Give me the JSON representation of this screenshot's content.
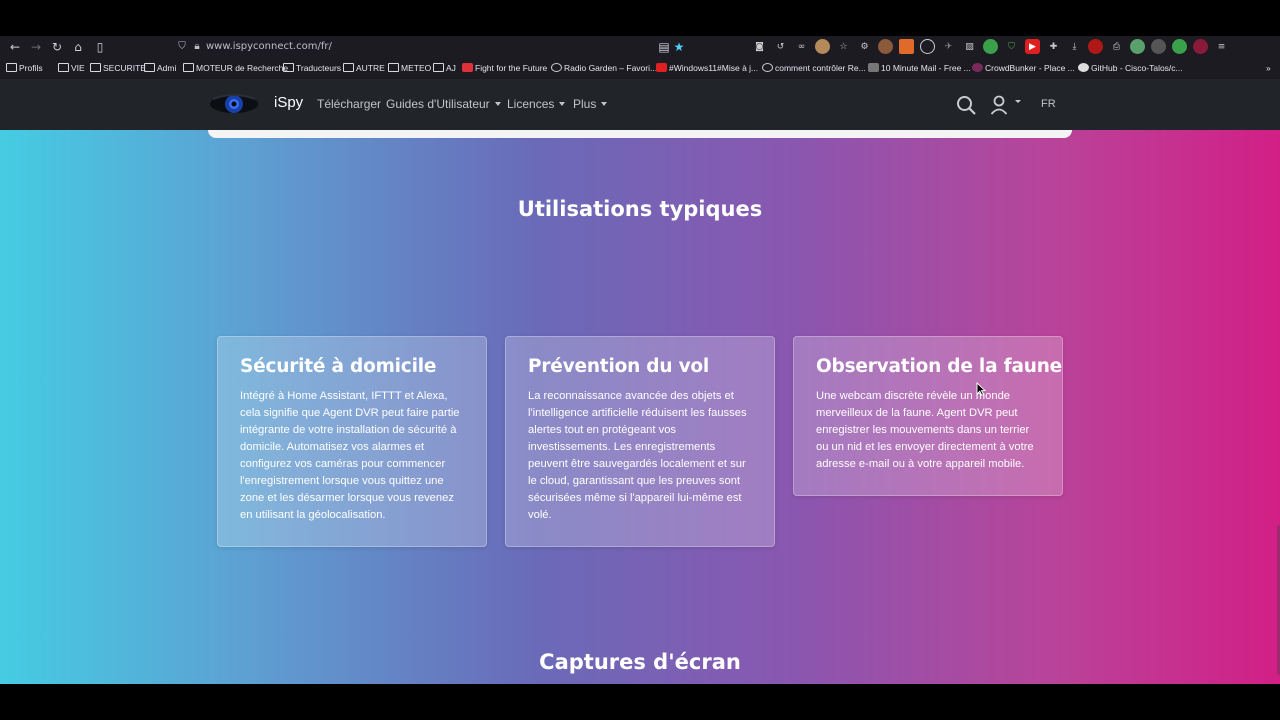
{
  "browser": {
    "url": "www.ispyconnect.com/fr/",
    "bookmarks": [
      "Profils",
      "VIE",
      "SECURITE",
      "Admi",
      "MOTEUR de Recherche",
      "Traducteurs",
      "AUTRE",
      "METEO",
      "AJ",
      "Fight for the Future",
      "Radio Garden – Favori...",
      "#Windows11#Mise à j...",
      "comment contrôler Re...",
      "10 Minute Mail - Free ...",
      "CrowdBunker - Place ...",
      "GitHub - Cisco-Talos/c..."
    ]
  },
  "site_nav": {
    "brand": "iSpy",
    "items": [
      "Télécharger",
      "Guides d'Utilisateur",
      "Licences",
      "Plus"
    ],
    "lang": "FR"
  },
  "section": {
    "title": "Utilisations typiques",
    "cards": [
      {
        "title": "Sécurité à domicile",
        "text": "Intégré à Home Assistant, IFTTT et Alexa, cela signifie que Agent DVR peut faire partie intégrante de votre installation de sécurité à domicile. Automatisez vos alarmes et configurez vos caméras pour commencer l'enregistrement lorsque vous quittez une zone et les désarmer lorsque vous revenez en utilisant la géolocalisation."
      },
      {
        "title": "Prévention du vol",
        "text": "La reconnaissance avancée des objets et l'intelligence artificielle réduisent les fausses alertes tout en protégeant vos investissements. Les enregistrements peuvent être sauvegardés localement et sur le cloud, garantissant que les preuves sont sécurisées même si l'appareil lui-même est volé."
      },
      {
        "title": "Observation de la faune",
        "text": "Une webcam discrète révèle un monde merveilleux de la faune. Agent DVR peut enregistrer les mouvements dans un terrier ou un nid et les envoyer directement à votre adresse e-mail ou à votre appareil mobile."
      }
    ]
  },
  "next_section": {
    "title": "Captures d'écran"
  },
  "colors": {
    "gradient_start": "#45cce3",
    "gradient_mid": "#6a6ab8",
    "gradient_end": "#d21f86",
    "navbar": "#212529"
  }
}
